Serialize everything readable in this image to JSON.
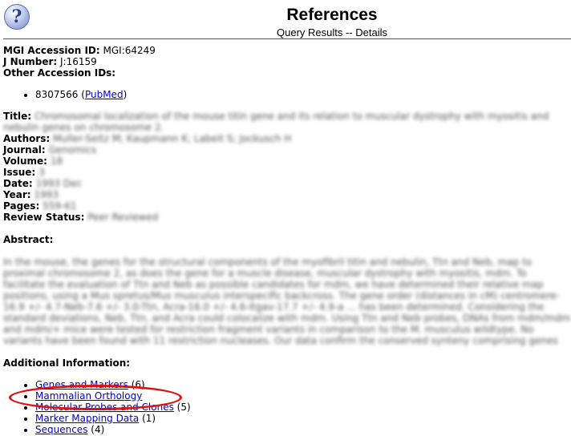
{
  "header": {
    "help_glyph": "?",
    "title": "References",
    "subtitle": "Query Results -- Details"
  },
  "details": {
    "mgi_label": "MGI Accession ID:",
    "mgi_value": "MGI:64249",
    "jnum_label": "J Number:",
    "jnum_value": "J:16159",
    "other_ids_label": "Other Accession IDs:",
    "other_id_number": "8307566",
    "other_id_link": "PubMed",
    "title_label": "Title:",
    "title_value": "Chromosomal localization of the mouse titin gene and its relation to muscular dystrophy with myositis and nebulin genes on chromosome 2.",
    "authors_label": "Authors:",
    "authors_value": "Muller-Seitz M; Kaupmann K; Labeit S; Jockusch H",
    "journal_label": "Journal:",
    "journal_value": "Genomics",
    "volume_label": "Volume:",
    "volume_value": "18",
    "issue_label": "Issue:",
    "issue_value": "3",
    "date_label": "Date:",
    "date_value": "1993 Dec",
    "year_label": "Year:",
    "year_value": "1993",
    "pages_label": "Pages:",
    "pages_value": "559-61",
    "review_label": "Review Status:",
    "review_value": "Peer Reviewed"
  },
  "abstract": {
    "label": "Abstract:",
    "text": "In the mouse, the genes for the structural components of the myofibril titin and nebulin, Ttn and Neb, map to proximal chromosome 2, as does the gene for a muscle disease, muscular dystrophy with myositis, mdm. To facilitate the evaluation of Ttn and Neb as possible candidates for mdm, we have determined their relative map positions, using a Mus spretus/Mus musculus interspecific backcross. The gene order (distances in cM) centromere-16.9 +/- 4.7-Neb-7.6 +/- 3.0-Ttn, Acra-16.0 +/- 4.6-Itgav-17.7 +/- 4.9-a ... has been determined. Considering the standard deviations, Neb, Ttn, and Acra could colocalize with mdm. Using Ttn and Neb probes, DNAs from mdm/mdm and mdm/+ mice were tested for restriction fragment variants in comparison to the M. musculus wildtype. No variants have been found with 11 restriction nucleases. Our data confirm the conserved synteny comprising genes NEB, TTN, CHRNA1 on human Chr 2q."
  },
  "additional": {
    "label": "Additional Information:",
    "links": [
      {
        "text": "Genes and Markers",
        "count": "(6)"
      },
      {
        "text": "Mammalian Orthology",
        "count": ""
      },
      {
        "text": "Molecular Probes and Clones",
        "count": "(5)"
      },
      {
        "text": "Marker Mapping Data",
        "count": "(1)"
      },
      {
        "text": "Sequences",
        "count": "(4)"
      }
    ]
  },
  "annotation": {
    "color": "#e01010"
  }
}
